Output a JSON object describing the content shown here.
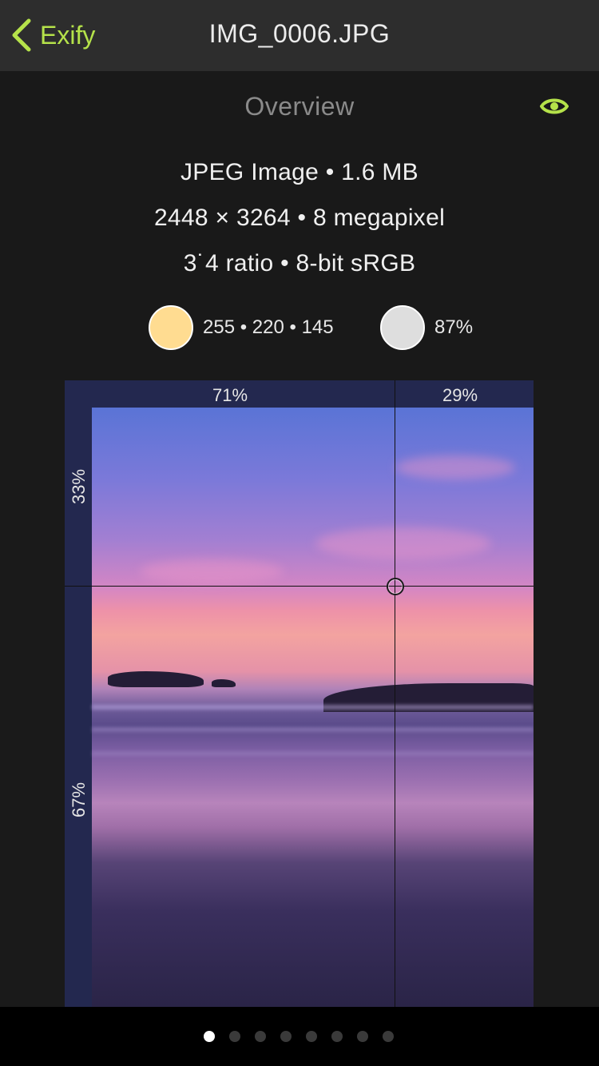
{
  "nav": {
    "back_label": "Exify",
    "title": "IMG_0006.JPG"
  },
  "overview": {
    "title": "Overview",
    "line1": "JPEG Image • 1.6 MB",
    "line2": "2448 × 3264 • 8 megapixel",
    "line3": "3˙4 ratio • 8-bit sRGB",
    "dominant_color": {
      "hex": "#ffdc91",
      "label": "255 • 220 • 145"
    },
    "brightness": {
      "hex": "#dedede",
      "label": "87%"
    },
    "accent": "#b5e24a"
  },
  "photo": {
    "top_left_pct": "71%",
    "top_right_pct": "29%",
    "side_top_pct": "33%",
    "side_bottom_pct": "67%"
  },
  "pager": {
    "page_count": 8,
    "current_page": 1
  },
  "icons": {
    "back": "chevron-left-icon",
    "eye": "eye-icon"
  }
}
